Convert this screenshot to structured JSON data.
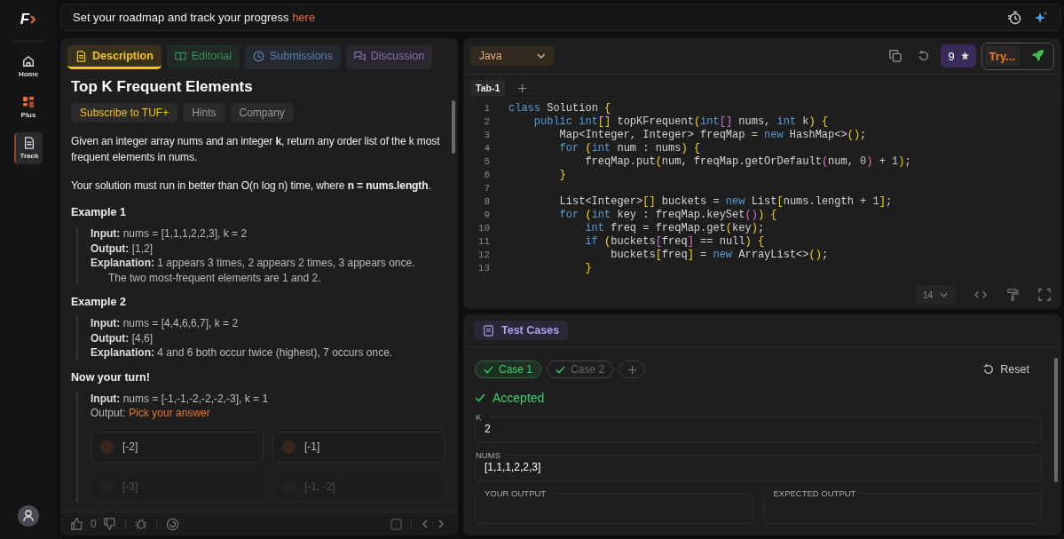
{
  "sidebar": {
    "logo": "F",
    "items": [
      {
        "label": "Home",
        "selected": false
      },
      {
        "label": "Plus",
        "selected": false
      },
      {
        "label": "Track",
        "selected": true
      }
    ]
  },
  "banner": {
    "text": "Set your roadmap and track your progress",
    "link": "here"
  },
  "problem": {
    "tabs": [
      {
        "label": "Description",
        "color": "#f5c518",
        "selected": true
      },
      {
        "label": "Editorial",
        "color": "#3f8f5a",
        "selected": false
      },
      {
        "label": "Submissions",
        "color": "#5b7fb3",
        "selected": false
      },
      {
        "label": "Discussion",
        "color": "#8d6fb0",
        "selected": false
      }
    ],
    "title": "Top K Frequent Elements",
    "tags": [
      {
        "label": "Subscribe to TUF+",
        "kind": "premium"
      },
      {
        "label": "Hints",
        "kind": "plain"
      },
      {
        "label": "Company",
        "kind": "plain"
      }
    ],
    "paragraphs": [
      "Given an integer array nums and an integer **k**, return any order list of the k most frequent elements in nums.",
      "Your solution must run in better than O(n log n) time, where **n = nums.length**."
    ],
    "examples": [
      {
        "heading": "Example 1",
        "lines": [
          {
            "text": "**Input:** nums = [1,1,1,2,2,3], k = 2",
            "kind": "line"
          },
          {
            "text": "**Output:** [1,2]",
            "kind": "line"
          },
          {
            "text": "**Explanation:** 1 appears 3 times, 2 appears 2 times, 3 appears once.",
            "kind": "line"
          },
          {
            "text": "The two most-frequent elements are 1 and 2.",
            "kind": "continuation"
          }
        ]
      },
      {
        "heading": "Example 2",
        "lines": [
          {
            "text": "**Input:** nums = [4,4,6,6,7], k = 2",
            "kind": "line"
          },
          {
            "text": "**Output:** [4,6]",
            "kind": "line"
          },
          {
            "text": "**Explanation:** 4 and 6 both occur twice (highest), 7 occurs once.",
            "kind": "line"
          }
        ]
      }
    ],
    "quiz": {
      "heading": "Now your turn!",
      "input": "**Input:** nums = [-1,-1,-2,-2,-2,-3], k = 1",
      "output_label": "Output:",
      "prompt": "Pick your answer",
      "options": [
        {
          "label": "[-2]",
          "selected": false
        },
        {
          "label": "[-1]",
          "selected": false
        },
        {
          "label": "[-3]",
          "selected": false
        },
        {
          "label": "[-1, -2]",
          "selected": false
        }
      ]
    },
    "footer": {
      "likes": "0"
    }
  },
  "editor": {
    "language": "Java",
    "credits": "9",
    "try_label": "Try...",
    "tabs": [
      {
        "label": "Tab-1",
        "selected": true
      }
    ],
    "font_size": "14",
    "lines": [
      {
        "number": "1",
        "code": "class Solution {"
      },
      {
        "number": "2",
        "code": "    public int[] topKFrequent(int[] nums, int k) {"
      },
      {
        "number": "3",
        "code": "        Map<Integer, Integer> freqMap = new HashMap<>();"
      },
      {
        "number": "4",
        "code": "        for (int num : nums) {"
      },
      {
        "number": "5",
        "code": "            freqMap.put(num, freqMap.getOrDefault(num, 0) + 1);"
      },
      {
        "number": "6",
        "code": "        }"
      },
      {
        "number": "7"
      },
      {
        "number": "8",
        "code": "        List<Integer>[] buckets = new List[nums.length + 1];"
      },
      {
        "number": "9",
        "code": "        for (int key : freqMap.keySet()) {"
      },
      {
        "number": "10",
        "code": "            int freq = freqMap.get(key);"
      },
      {
        "number": "11",
        "code": "            if (buckets[freq] == null) {"
      },
      {
        "number": "12",
        "code": "                buckets[freq] = new ArrayList<>();"
      },
      {
        "number": "13",
        "code": "            }"
      }
    ]
  },
  "tests": {
    "tab": "Test Cases",
    "cases": [
      {
        "label": "Case 1",
        "selected": true
      },
      {
        "label": "Case 2",
        "selected": false
      }
    ],
    "reset": "Reset",
    "status": "Accepted",
    "inputs": [
      {
        "label": "K",
        "value": "2"
      },
      {
        "label": "NUMS",
        "value": "[1,1,1,2,2,3]"
      }
    ],
    "outputs": [
      {
        "label": "YOUR OUTPUT"
      },
      {
        "label": "EXPECTED OUTPUT"
      }
    ]
  }
}
